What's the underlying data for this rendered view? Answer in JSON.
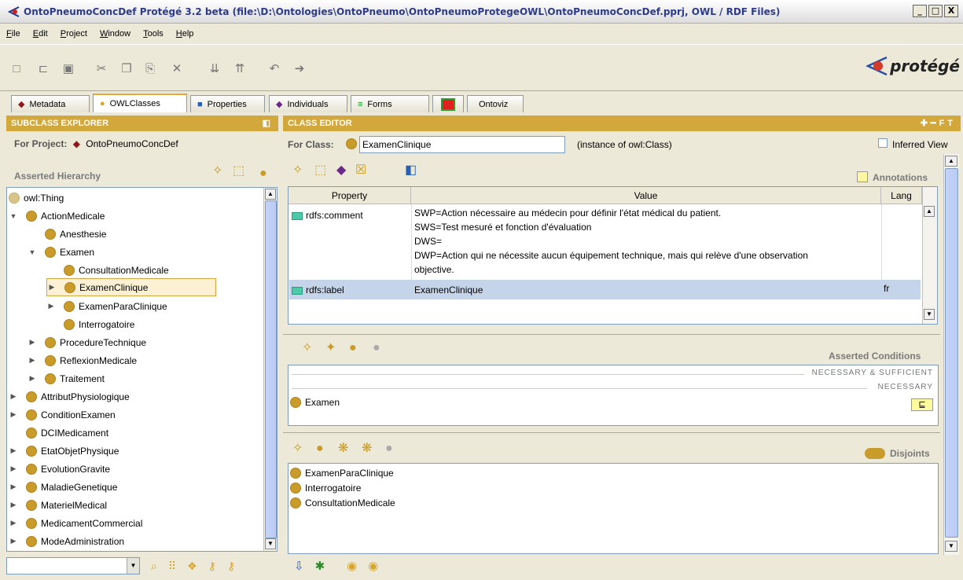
{
  "window": {
    "title": "OntoPneumoConcDef  Protégé 3.2 beta   (file:\\D:\\Ontologies\\OntoPneumo\\OntoPneumoProtegeOWL\\OntoPneumoConcDef.pprj, OWL / RDF Files)",
    "minimize": "_",
    "maximize": "□",
    "close": "X"
  },
  "menu": [
    "File",
    "Edit",
    "Project",
    "Window",
    "Tools",
    "Help"
  ],
  "logo_text": "protégé",
  "tabs": [
    {
      "label": "Metadata",
      "glyph": "◆",
      "color": "#8b1a1a"
    },
    {
      "label": "OWLClasses",
      "glyph": "●",
      "color": "#d8a430"
    },
    {
      "label": "Properties",
      "glyph": "■",
      "color": "#2a5fb0"
    },
    {
      "label": "Individuals",
      "glyph": "◆",
      "color": "#6a2a8a"
    },
    {
      "label": "Forms",
      "glyph": "≡",
      "color": "#1f9a2a"
    },
    {
      "label": "",
      "glyph": "■",
      "color": "#e02020"
    },
    {
      "label": "Ontoviz",
      "glyph": "",
      "color": ""
    }
  ],
  "left_panel": {
    "header": "SUBCLASS EXPLORER",
    "project_label": "For Project:",
    "project_name": "OntoPneumoConcDef",
    "hierarchy_label": "Asserted Hierarchy",
    "tree": [
      {
        "label": "owl:Thing",
        "depth": 0,
        "toggle": "",
        "thing": true
      },
      {
        "label": "ActionMedicale",
        "depth": 0,
        "toggle": "▼"
      },
      {
        "label": "Anesthesie",
        "depth": 1,
        "toggle": ""
      },
      {
        "label": "Examen",
        "depth": 1,
        "toggle": "▼"
      },
      {
        "label": "ConsultationMedicale",
        "depth": 2,
        "toggle": ""
      },
      {
        "label": "ExamenClinique",
        "depth": 2,
        "toggle": "▶",
        "selected": true
      },
      {
        "label": "ExamenParaClinique",
        "depth": 2,
        "toggle": "▶"
      },
      {
        "label": "Interrogatoire",
        "depth": 2,
        "toggle": ""
      },
      {
        "label": "ProcedureTechnique",
        "depth": 1,
        "toggle": "▶"
      },
      {
        "label": "ReflexionMedicale",
        "depth": 1,
        "toggle": "▶"
      },
      {
        "label": "Traitement",
        "depth": 1,
        "toggle": "▶"
      },
      {
        "label": "AttributPhysiologique",
        "depth": 0,
        "toggle": "▶"
      },
      {
        "label": "ConditionExamen",
        "depth": 0,
        "toggle": "▶"
      },
      {
        "label": "DCIMedicament",
        "depth": 0,
        "toggle": ""
      },
      {
        "label": "EtatObjetPhysique",
        "depth": 0,
        "toggle": "▶"
      },
      {
        "label": "EvolutionGravite",
        "depth": 0,
        "toggle": "▶"
      },
      {
        "label": "MaladieGenetique",
        "depth": 0,
        "toggle": "▶"
      },
      {
        "label": "MaterielMedical",
        "depth": 0,
        "toggle": "▶"
      },
      {
        "label": "MedicamentCommercial",
        "depth": 0,
        "toggle": "▶"
      },
      {
        "label": "ModeAdministration",
        "depth": 0,
        "toggle": "▶"
      }
    ]
  },
  "right_panel": {
    "header": "CLASS EDITOR",
    "class_label": "For Class:",
    "class_name": "ExamenClinique",
    "instance_of": "(instance of owl:Class)",
    "inferred_view": "Inferred View",
    "annotations_title": "Annotations",
    "columns": {
      "property": "Property",
      "value": "Value",
      "lang": "Lang"
    },
    "rows": [
      {
        "property": "rdfs:comment",
        "value_lines": [
          "SWP=Action nécessaire au médecin pour définir l'état médical du patient.",
          "SWS=Test mesuré et fonction d'évaluation",
          "DWS=",
          "DWP=Action qui ne nécessite aucun équipement technique, mais qui relève d'une observation",
          "objective."
        ],
        "lang": ""
      },
      {
        "property": "rdfs:label",
        "value_lines": [
          "ExamenClinique"
        ],
        "lang": "fr"
      }
    ],
    "conditions_title": "Asserted Conditions",
    "nec_suff": "NECESSARY & SUFFICIENT",
    "necessary": "NECESSARY",
    "condition_item": "Examen",
    "condition_symbol": "⊑",
    "disjoints_title": "Disjoints",
    "disjoints": [
      "ExamenParaClinique",
      "Interrogatoire",
      "ConsultationMedicale"
    ]
  }
}
